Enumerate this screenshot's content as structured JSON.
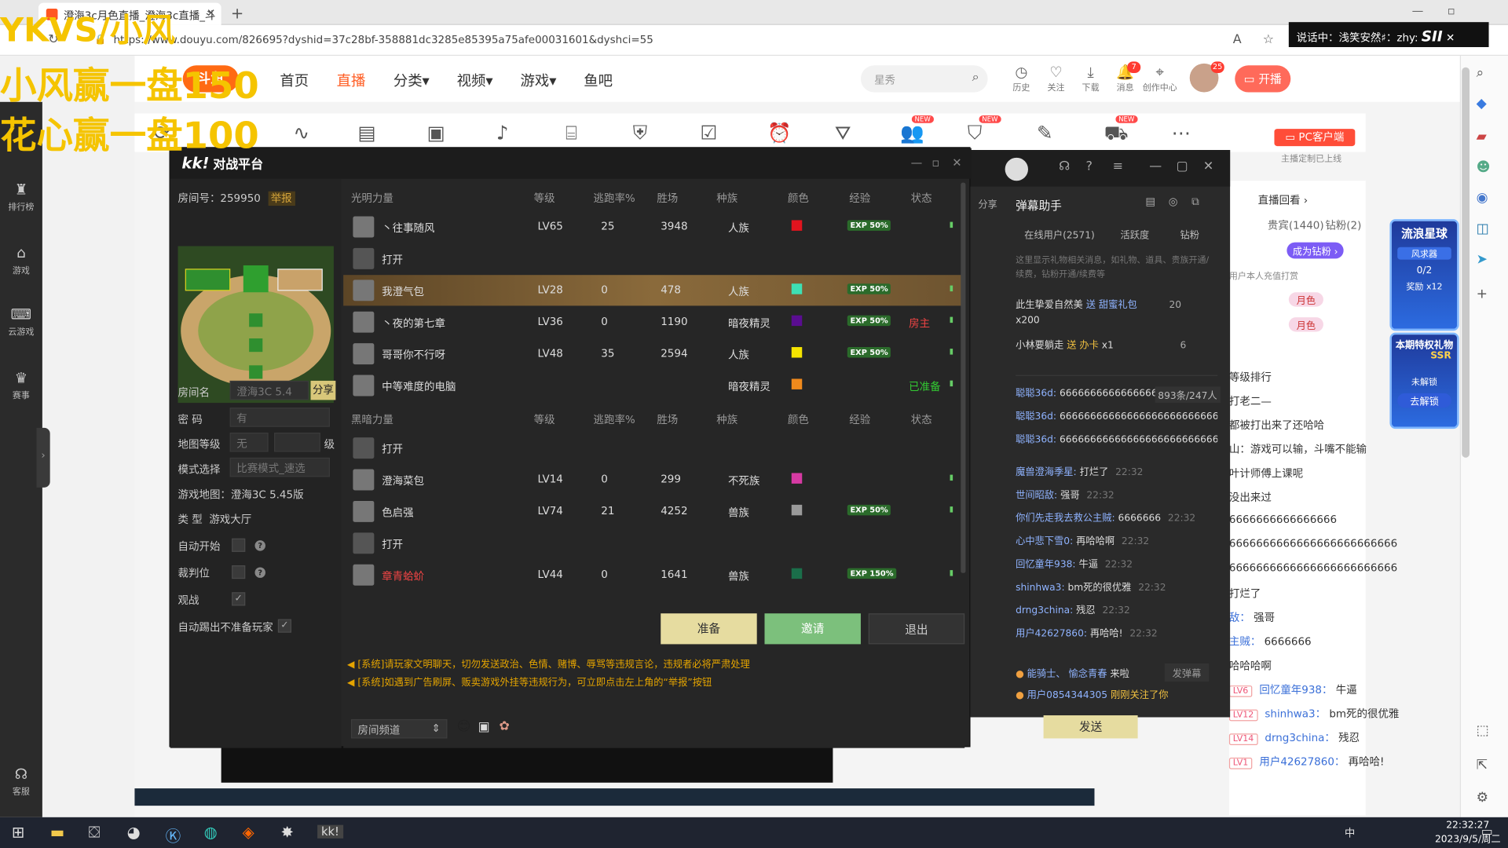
{
  "browser": {
    "tab_title": "澄海3c月色直播_澄海3c直播_斗",
    "url": "https://www.douyu.com/826695?dyshid=37c28bf-358881dc3285e85395a75afe00031601&dyshci=55"
  },
  "overlay": {
    "line1": "YKVS/小风",
    "line2": "小风赢一盘150",
    "line3": "花心赢一盘100"
  },
  "call": {
    "text": "说话中：浅笑安然♯：zhy:"
  },
  "douyu": {
    "logo": "斗鱼",
    "nav": [
      "首页",
      "直播",
      "分类▾",
      "视频▾",
      "游戏▾",
      "鱼吧"
    ],
    "search_placeholder": "星秀",
    "header_icons": [
      {
        "label": "历史",
        "icon": "clock-icon"
      },
      {
        "label": "关注",
        "icon": "heart-icon"
      },
      {
        "label": "下载",
        "icon": "download-icon"
      },
      {
        "label": "消息",
        "icon": "bell-icon",
        "badge": "7"
      },
      {
        "label": "创作中心",
        "icon": "pin-icon"
      }
    ],
    "avatar_badge": "25",
    "kaibo": "开播",
    "pc_client": "PC客户端",
    "pc_sub": "主播定制已上线"
  },
  "left_sidebar": [
    {
      "label": "排行榜",
      "icon": "rank-icon"
    },
    {
      "label": "游戏",
      "icon": "mouse-icon"
    },
    {
      "label": "云游戏",
      "icon": "gamepad-icon"
    },
    {
      "label": "赛事",
      "icon": "trophy-icon"
    },
    {
      "label": "客服",
      "icon": "headset-icon"
    }
  ],
  "right_panel": {
    "replay": "直播回看 ›",
    "tabs": [
      "贵宾(1440)",
      "钻粉(2)"
    ],
    "become_fan": "成为钻粉 ›",
    "room_note": "用户本人充值打赏",
    "chat": [
      {
        "lv": "",
        "user": "",
        "text": "等级排行"
      },
      {
        "lv": "",
        "user": "",
        "text": "打老二—"
      },
      {
        "lv": "",
        "user": "",
        "text": "都被打出来了还哈哈"
      },
      {
        "lv": "",
        "user": "",
        "text": "山：游戏可以输，斗嘴不能输"
      },
      {
        "lv": "",
        "user": "",
        "text": "叶计师傅上课呢"
      },
      {
        "lv": "",
        "user": "",
        "text": "没出来过"
      },
      {
        "lv": "",
        "user": "",
        "text": "6666666666666666"
      },
      {
        "lv": "",
        "user": "",
        "text": "6666666666666666666666666"
      },
      {
        "lv": "",
        "user": "",
        "text": "6666666666666666666666666"
      },
      {
        "lv": "",
        "user": "",
        "text": "打烂了"
      },
      {
        "lv": "",
        "user": "敌：",
        "text": "强哥"
      },
      {
        "lv": "",
        "user": "主贼：",
        "text": "6666666"
      },
      {
        "lv": "",
        "user": "",
        "text": "哈哈哈啊"
      },
      {
        "lv": "LV6",
        "user": "回忆童年938：",
        "text": "牛逼"
      },
      {
        "lv": "LV12",
        "user": "shinhwa3：",
        "text": "bm死的很优雅"
      },
      {
        "lv": "LV14",
        "user": "drng3china：",
        "text": "残忍"
      },
      {
        "lv": "LV1",
        "user": "用户42627860：",
        "text": "再哈哈!"
      }
    ],
    "promo1": {
      "title": "流浪星球",
      "label": "风求器",
      "progress": "0/2",
      "reward": "奖励",
      "count": "x12"
    },
    "promo2": {
      "title": "本期特权礼物",
      "tag": "SSR",
      "sub": "未解锁",
      "btn": "去解锁"
    }
  },
  "kk": {
    "title_logo": "kk!",
    "title": "对战平台",
    "room_no_label": "房间号：",
    "room_no": "259950",
    "report": "举报",
    "room_name_label": "房间名",
    "room_name": "澄海3C 5.4",
    "share": "分享",
    "password_label": "密  码",
    "password": "有",
    "map_level_label": "地图等级",
    "map_level": "无",
    "map_level_unit": "级",
    "mode_label": "模式选择",
    "mode": "比赛模式_速选",
    "game_map_label": "游戏地图：",
    "game_map": "澄海3C 5.45版",
    "type_label": "类  型",
    "type": "游戏大厅",
    "auto_start_label": "自动开始",
    "referee_label": "裁判位",
    "observe_label": "观战",
    "auto_kick_label": "自动踢出不准备玩家",
    "col": {
      "level": "等级",
      "escape": "逃跑率%",
      "wins": "胜场",
      "race": "种族",
      "color": "颜色",
      "exp": "经验",
      "status": "状态"
    },
    "team1": "光明力量",
    "team2": "黑暗力量",
    "players1": [
      {
        "name": "丶往事随风",
        "lv": "LV65",
        "esc": "25",
        "wins": "3948",
        "race": "人族",
        "color": "#e0141e",
        "exp": "EXP 50%",
        "status": ""
      },
      {
        "name": "打开",
        "lv": "",
        "esc": "",
        "wins": "",
        "race": "",
        "color": "",
        "exp": "",
        "status": ""
      },
      {
        "name": "我澄气包",
        "lv": "LV28",
        "esc": "0",
        "wins": "478",
        "race": "人族",
        "color": "#3ee0b4",
        "exp": "EXP 50%",
        "status": ""
      },
      {
        "name": "丶夜的第七章",
        "lv": "LV36",
        "esc": "0",
        "wins": "1190",
        "race": "暗夜精灵",
        "color": "#5a0d91",
        "exp": "EXP 50%",
        "status": "房主"
      },
      {
        "name": "哥哥你不行呀",
        "lv": "LV48",
        "esc": "35",
        "wins": "2594",
        "race": "人族",
        "color": "#f5e400",
        "exp": "EXP 50%",
        "status": ""
      },
      {
        "name": "中等难度的电脑",
        "lv": "",
        "esc": "",
        "wins": "",
        "race": "暗夜精灵",
        "color": "#f08a1c",
        "exp": "",
        "status": "已准备"
      }
    ],
    "players2": [
      {
        "name": "打开",
        "lv": "",
        "esc": "",
        "wins": "",
        "race": "",
        "color": "",
        "exp": "",
        "status": ""
      },
      {
        "name": "澄海菜包",
        "lv": "LV14",
        "esc": "0",
        "wins": "299",
        "race": "不死族",
        "color": "#d63aa3",
        "exp": "",
        "status": ""
      },
      {
        "name": "色启强",
        "lv": "LV74",
        "esc": "21",
        "wins": "4252",
        "race": "兽族",
        "color": "#9a9a9a",
        "exp": "EXP 50%",
        "status": ""
      },
      {
        "name": "打开",
        "lv": "",
        "esc": "",
        "wins": "",
        "race": "",
        "color": "",
        "exp": "",
        "status": ""
      },
      {
        "name": "章青蛤蚧",
        "lv": "LV44",
        "esc": "0",
        "wins": "1641",
        "race": "兽族",
        "color": "#1a6e4a",
        "exp": "EXP 150%",
        "status": ""
      }
    ],
    "btn_ready": "准备",
    "btn_invite": "邀请",
    "btn_exit": "退出",
    "sys1": "[系统]请玩家文明聊天，切勿发送政治、色情、赌博、辱骂等违规言论，违规者必将严肃处理",
    "sys2": "[系统]如遇到广告刷屏、贩卖游戏外挂等违规行为，可立即点击左上角的“举报”按钮",
    "channel": "房间频道",
    "send": "发送"
  },
  "danmu": {
    "title": "弹幕助手",
    "tabs": [
      "在线用户(2571)",
      "活跃度",
      "钻粉"
    ],
    "hint": "这里显示礼物相关消息，如礼物、道具、贵族开通/续费，钻粉开通/续费等",
    "gift1": {
      "user": "此生挚爱自然美",
      "act": "送 甜蜜礼包",
      "count": "20",
      "extra": "x200"
    },
    "gift2": {
      "user": "小林要躺走",
      "act": "送 办卡",
      "count": "x1",
      "num": "6"
    },
    "viewers": "893条/247人",
    "msgs": [
      {
        "user": "聪聪36d:",
        "text": "666666666666666666",
        "time": ""
      },
      {
        "user": "聪聪36d:",
        "text": "6666666666666666666666666666",
        "time": "22:32"
      },
      {
        "user": "聪聪36d:",
        "text": "6666666666666666666666666666",
        "time": "22:32"
      },
      {
        "user": "魔兽澄海季星:",
        "text": "打烂了",
        "time": "22:32"
      },
      {
        "user": "世间昭敌:",
        "text": "强哥",
        "time": "22:32"
      },
      {
        "user": "你们先走我去救公主贼:",
        "text": "6666666",
        "time": "22:32"
      },
      {
        "user": "心中悲下雪0:",
        "text": "再哈哈啊",
        "time": "22:32"
      },
      {
        "user": "回忆童年938:",
        "text": "牛逼",
        "time": "22:32"
      },
      {
        "user": "shinhwa3:",
        "text": "bm死的很优雅",
        "time": "22:32"
      },
      {
        "user": "drng3china:",
        "text": "残忍",
        "time": "22:32"
      },
      {
        "user": "用户42627860:",
        "text": "再哈哈!",
        "time": "22:32"
      }
    ],
    "enter": {
      "user": "能骑士、 愉念青春",
      "act": "来啦"
    },
    "follow": {
      "user": "用户0854344305",
      "act": "刚刚关注了你"
    },
    "send_btn": "发弹幕",
    "share": "分享"
  },
  "taskbar": {
    "time": "22:32:27",
    "date": "2023/9/5/周二",
    "ime": "中"
  }
}
